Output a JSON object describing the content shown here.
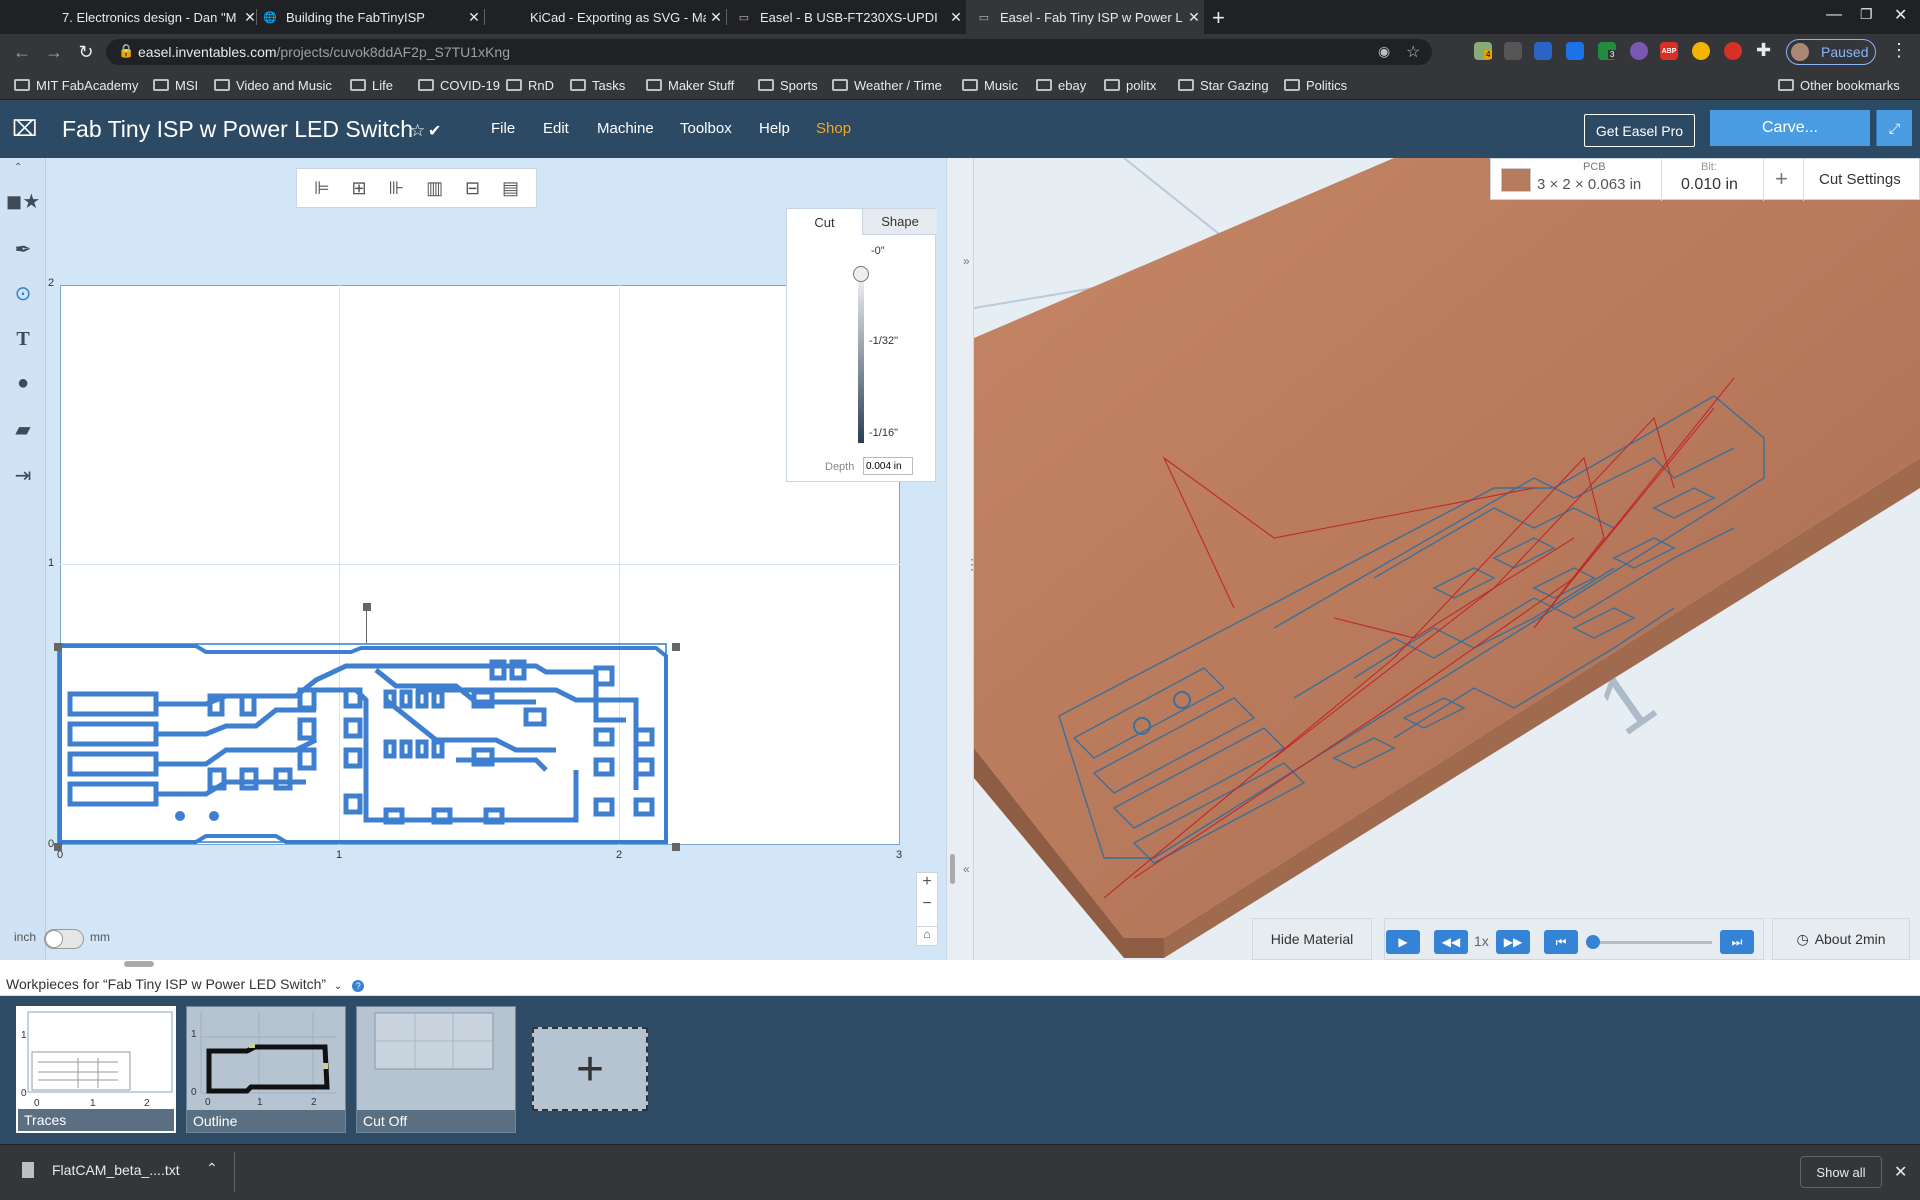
{
  "browser": {
    "tabs": [
      {
        "title": "7. Electronics design - Dan \"M",
        "favicon": "fabacademy-icon"
      },
      {
        "title": "Building the FabTinyISP",
        "favicon": "globe-icon"
      },
      {
        "title": "KiCad - Exporting as SVG - Ma",
        "favicon": "kicad-icon"
      },
      {
        "title": "Easel - B USB-FT230XS-UPDI",
        "favicon": "easel-icon"
      },
      {
        "title": "Easel - Fab Tiny ISP w Power L",
        "favicon": "easel-icon"
      }
    ],
    "url_host": "easel.inventables.com",
    "url_path": "/projects/cuvok8ddAF2p_S7TU1xKng",
    "profile_status": "Paused",
    "extension_badge_1": "4",
    "extension_badge_2": "3",
    "abp": "ABP",
    "bookmarks": [
      "MIT FabAcademy",
      "MSI",
      "Video and Music",
      "Life",
      "COVID-19",
      "RnD",
      "Tasks",
      "Maker Stuff",
      "Sports",
      "Weather / Time",
      "Music",
      "ebay",
      "politx",
      "Star Gazing",
      "Politics"
    ],
    "other_bookmarks": "Other bookmarks"
  },
  "app": {
    "project_title": "Fab Tiny ISP w Power LED Switch",
    "menu": [
      "File",
      "Edit",
      "Machine",
      "Toolbox",
      "Help",
      "Shop"
    ],
    "get_pro": "Get Easel Pro",
    "carve": "Carve..."
  },
  "canvas": {
    "x_ticks": [
      "0",
      "1",
      "2",
      "3"
    ],
    "y_ticks": [
      "2",
      "1",
      "0"
    ],
    "unit_left": "inch",
    "unit_right": "mm"
  },
  "cut_panel": {
    "tab_cut": "Cut",
    "tab_shape": "Shape",
    "depth_top": "-0\"",
    "depth_mid": "-1/32\"",
    "depth_bottom": "-1/16\"",
    "depth_label": "Depth",
    "depth_value": "0.004 in",
    "depth_fraction": 0.06
  },
  "material": {
    "name": "PCB",
    "size": "3 × 2 × 0.063 in",
    "bit_label": "Bit:",
    "bit_value": "0.010 in",
    "add": "+",
    "cut_settings": "Cut Settings",
    "color": "#b67a5c"
  },
  "preview": {
    "hide_material": "Hide Material",
    "speed": "1x",
    "time": "About 2min",
    "progress": 0,
    "axis_label": "1"
  },
  "workpieces": {
    "header": "Workpieces for “Fab Tiny ISP w Power LED Switch”",
    "help": "?",
    "items": [
      {
        "label": "Traces",
        "ticks_x": [
          "0",
          "1",
          "2"
        ],
        "ticks_y": [
          "1",
          "0"
        ]
      },
      {
        "label": "Outline",
        "ticks_x": [
          "0",
          "1",
          "2"
        ],
        "ticks_y": [
          "1",
          "0"
        ]
      },
      {
        "label": "Cut Off"
      }
    ]
  },
  "download": {
    "file": "FlatCAM_beta_....txt",
    "show_all": "Show all"
  },
  "colors": {
    "header": "#2d4a64",
    "accent": "#4a9de2",
    "trace": "#3f7fd0",
    "shop": "#f5a623"
  }
}
